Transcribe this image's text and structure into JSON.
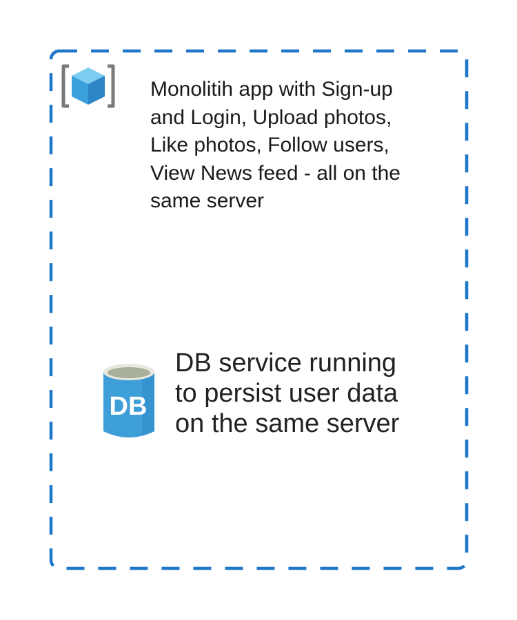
{
  "diagram": {
    "boundary_color": "#1f77c9",
    "app_node": {
      "icon": "app-cube-icon",
      "text": "Monolitih app with Sign-up\nand Login, Upload photos,\nLike photos, Follow users,\nView News feed - all on the\nsame server"
    },
    "db_node": {
      "icon": "database-icon",
      "icon_label": "DB",
      "text": "DB service running\nto persist user data\non the same server"
    }
  }
}
